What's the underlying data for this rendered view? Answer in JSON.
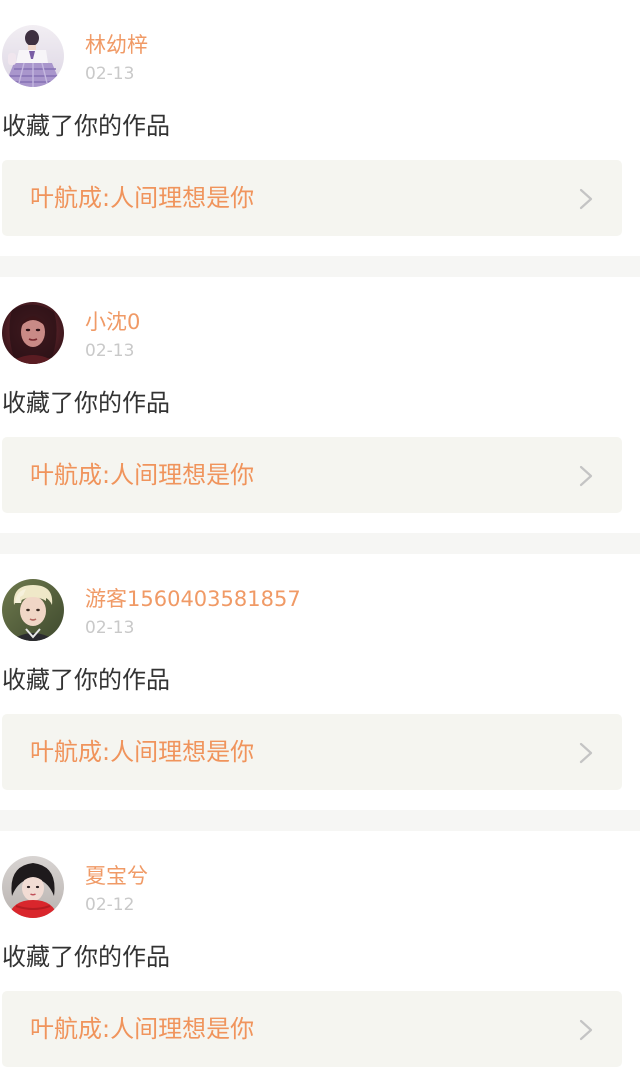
{
  "notifications": [
    {
      "username": "林幼梓",
      "date": "02-13",
      "action": "收藏了你的作品",
      "work_title": "叶航成:人间理想是你",
      "avatar_icon": "avatar-girl-lavender-uniform",
      "chevron_icon": "chevron-right-icon"
    },
    {
      "username": "小沈0",
      "date": "02-13",
      "action": "收藏了你的作品",
      "work_title": "叶航成:人间理想是你",
      "avatar_icon": "avatar-dark-red-portrait",
      "chevron_icon": "chevron-right-icon"
    },
    {
      "username": "游客1560403581857",
      "date": "02-13",
      "action": "收藏了你的作品",
      "work_title": "叶航成:人间理想是你",
      "avatar_icon": "avatar-blond-boy",
      "chevron_icon": "chevron-right-icon"
    },
    {
      "username": "夏宝兮",
      "date": "02-12",
      "action": "收藏了你的作品",
      "work_title": "叶航成:人间理想是你",
      "avatar_icon": "avatar-girl-red-scarf",
      "chevron_icon": "chevron-right-icon"
    }
  ],
  "colors": {
    "username": "#f09a66",
    "work_title": "#f0945c",
    "date": "#c9c9c9",
    "action_text": "#333333",
    "link_background": "#f5f5f0",
    "separator": "#f6f6f4"
  }
}
